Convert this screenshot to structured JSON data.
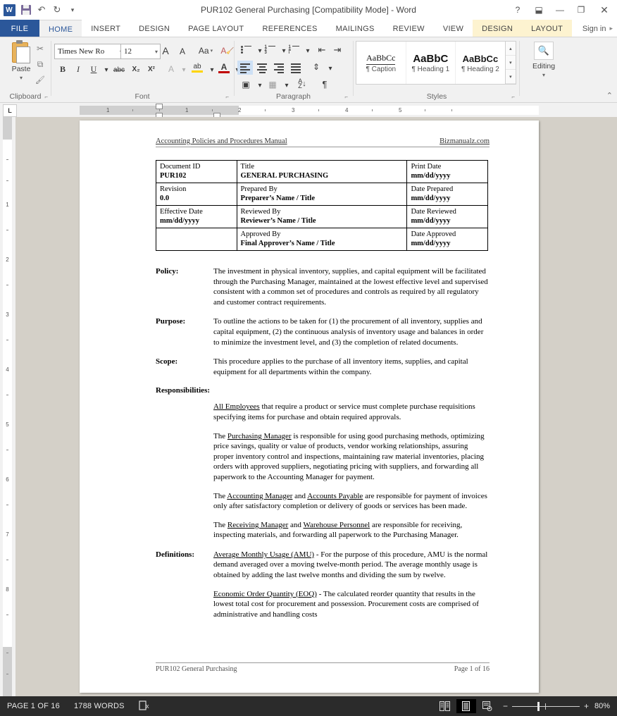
{
  "window": {
    "title": "PUR102 General Purchasing [Compatibility Mode] - Word",
    "quick_access": [
      {
        "name": "word-logo",
        "label": "W"
      },
      {
        "name": "save-icon",
        "label": ""
      },
      {
        "name": "undo-icon",
        "label": "↶"
      },
      {
        "name": "redo-icon",
        "label": "↻"
      },
      {
        "name": "customize-qat-icon",
        "label": "▾"
      }
    ],
    "controls": {
      "help": "?",
      "ribbon_display": "⬓",
      "minimize": "—",
      "restore": "❐",
      "close": "✕"
    }
  },
  "ribbon": {
    "file_tab": "FILE",
    "tabs": [
      {
        "label": "HOME",
        "active": true
      },
      {
        "label": "INSERT",
        "active": false
      },
      {
        "label": "DESIGN",
        "active": false
      },
      {
        "label": "PAGE LAYOUT",
        "active": false
      },
      {
        "label": "REFERENCES",
        "active": false
      },
      {
        "label": "MAILINGS",
        "active": false
      },
      {
        "label": "REVIEW",
        "active": false
      },
      {
        "label": "VIEW",
        "active": false
      }
    ],
    "contextual_tabs": [
      {
        "label": "DESIGN"
      },
      {
        "label": "LAYOUT"
      }
    ],
    "sign_in": "Sign in",
    "sign_in_caret": "▸",
    "collapse_ribbon": "⌃",
    "groups": {
      "clipboard": {
        "label": "Clipboard",
        "paste_label": "Paste",
        "paste_caret": "▾",
        "cut": "✂",
        "copy": "⧉",
        "format_painter": "🖌",
        "launcher": "⌐"
      },
      "font": {
        "label": "Font",
        "font_name": "Times New Ro",
        "font_size": "12",
        "grow_font": "A",
        "shrink_font": "A",
        "change_case": "Aa",
        "clear_formatting": "A",
        "bold": "B",
        "italic": "I",
        "underline": "U",
        "strikethrough": "abc",
        "subscript": "X₂",
        "superscript": "X²",
        "text_effects": "A",
        "text_highlight": "ab",
        "font_color": "A",
        "launcher": "⌐"
      },
      "paragraph": {
        "label": "Paragraph",
        "bullets": "bullets-icon",
        "numbering": "numbering-icon",
        "multilevel": "multilevel-list-icon",
        "decrease_indent": "⇤",
        "increase_indent": "⇥",
        "align_left": "align-left-icon",
        "align_center": "align-center-icon",
        "align_right": "align-right-icon",
        "justify": "justify-icon",
        "line_spacing": "⇕",
        "shading": "shading-icon",
        "borders": "borders-icon",
        "sort": "A↓Z",
        "show_marks": "¶",
        "launcher": "⌐"
      },
      "styles": {
        "label": "Styles",
        "items": [
          {
            "preview": "AaBbCc",
            "name": "¶ Caption",
            "kind": "caption"
          },
          {
            "preview": "AaBbC",
            "name": "¶ Heading 1",
            "kind": "h1"
          },
          {
            "preview": "AaBbCc",
            "name": "¶ Heading 2",
            "kind": "h2"
          }
        ],
        "scroll_up": "▴",
        "scroll_down": "▾",
        "more": "▾",
        "launcher": "⌐"
      },
      "editing": {
        "label": "Editing",
        "icon": "🔍",
        "caret": "▾"
      }
    }
  },
  "ruler": {
    "tab_stop_selector": "L",
    "horizontal_marks": [
      "1",
      "1",
      "2",
      "3",
      "4",
      "5"
    ],
    "vertical_marks": [
      "1",
      "2",
      "3",
      "4",
      "5",
      "6",
      "7",
      "8"
    ]
  },
  "document": {
    "header": {
      "left": "Accounting Policies and Procedures Manual",
      "right": "Bizmanualz.com"
    },
    "meta_table": [
      [
        {
          "label": "Document ID",
          "value": "PUR102"
        },
        {
          "label": "Title",
          "value": "GENERAL PURCHASING"
        },
        {
          "label": "Print Date",
          "value": "mm/dd/yyyy"
        }
      ],
      [
        {
          "label": "Revision",
          "value": "0.0"
        },
        {
          "label": "Prepared By",
          "value": "Preparer’s Name / Title"
        },
        {
          "label": "Date Prepared",
          "value": "mm/dd/yyyy"
        }
      ],
      [
        {
          "label": "Effective Date",
          "value": "mm/dd/yyyy"
        },
        {
          "label": "Reviewed By",
          "value": "Reviewer’s Name / Title"
        },
        {
          "label": "Date Reviewed",
          "value": "mm/dd/yyyy"
        }
      ],
      [
        {
          "label": "",
          "value": ""
        },
        {
          "label": "Approved By",
          "value": "Final Approver’s Name / Title"
        },
        {
          "label": "Date Approved",
          "value": "mm/dd/yyyy"
        }
      ]
    ],
    "sections": {
      "policy_term": "Policy:",
      "policy_body": "The investment in physical inventory, supplies, and capital equipment will be facilitated through the Purchasing Manager, maintained at the lowest effective level and supervised consistent with a common set of procedures and controls as required by all regulatory and customer contract requirements.",
      "purpose_term": "Purpose:",
      "purpose_body": "To outline the actions to be taken for (1) the procurement of all inventory, supplies and capital equipment, (2) the continuous analysis of inventory usage and balances in order to minimize the investment level, and (3) the completion of related documents.",
      "scope_term": "Scope:",
      "scope_body": "This procedure applies to the purchase of all inventory items, supplies, and capital equipment for all departments within the company.",
      "responsibilities_head": "Responsibilities:",
      "resp_1_link": "All Employees",
      "resp_1_rest": " that require a product or service must complete purchase requisitions specifying items for purchase and obtain required approvals.",
      "resp_2_pre": "The ",
      "resp_2_link": "Purchasing Manager",
      "resp_2_rest": " is responsible for using good purchasing methods, optimizing price savings, quality or value of products, vendor working relationships, assuring proper inventory control and inspections, maintaining raw material inventories, placing orders with approved suppliers, negotiating pricing with suppliers, and forwarding all paperwork to the Accounting Manager for payment.",
      "resp_3_pre": "The ",
      "resp_3_link_a": "Accounting Manager",
      "resp_3_mid": " and ",
      "resp_3_link_b": "Accounts Payable",
      "resp_3_rest": " are responsible for payment of invoices only after satisfactory completion or delivery of goods or services has been made.",
      "resp_4_pre": "The ",
      "resp_4_link_a": "Receiving Manager",
      "resp_4_mid": " and ",
      "resp_4_link_b": "Warehouse Personnel",
      "resp_4_rest": " are responsible for receiving, inspecting materials, and forwarding all paperwork to the Purchasing Manager.",
      "definitions_term": "Definitions:",
      "def_1_link": "Average Monthly Usage (AMU)",
      "def_1_rest": " - For the purpose of this procedure, AMU is the normal demand averaged over a moving twelve-month period. The average monthly usage is obtained by adding the last twelve months and dividing the sum by twelve.",
      "def_2_link": "Economic Order Quantity (EOQ)",
      "def_2_rest": " - The calculated reorder quantity that results in the lowest total cost for procurement and possession. Procurement costs are comprised of administrative and handling costs"
    },
    "footer": {
      "left": "PUR102 General Purchasing",
      "right": "Page 1 of 16"
    }
  },
  "status_bar": {
    "page_info": "PAGE 1 OF 16",
    "word_count": "1788 WORDS",
    "proofing_icon": "proofing-errors-icon",
    "views": [
      {
        "name": "read-mode-icon",
        "glyph": "▤",
        "active": false
      },
      {
        "name": "print-layout-icon",
        "glyph": "▤",
        "active": true
      },
      {
        "name": "web-layout-icon",
        "glyph": "▤",
        "active": false
      }
    ],
    "zoom_out": "−",
    "zoom_in": "+",
    "zoom_level": "80%"
  }
}
